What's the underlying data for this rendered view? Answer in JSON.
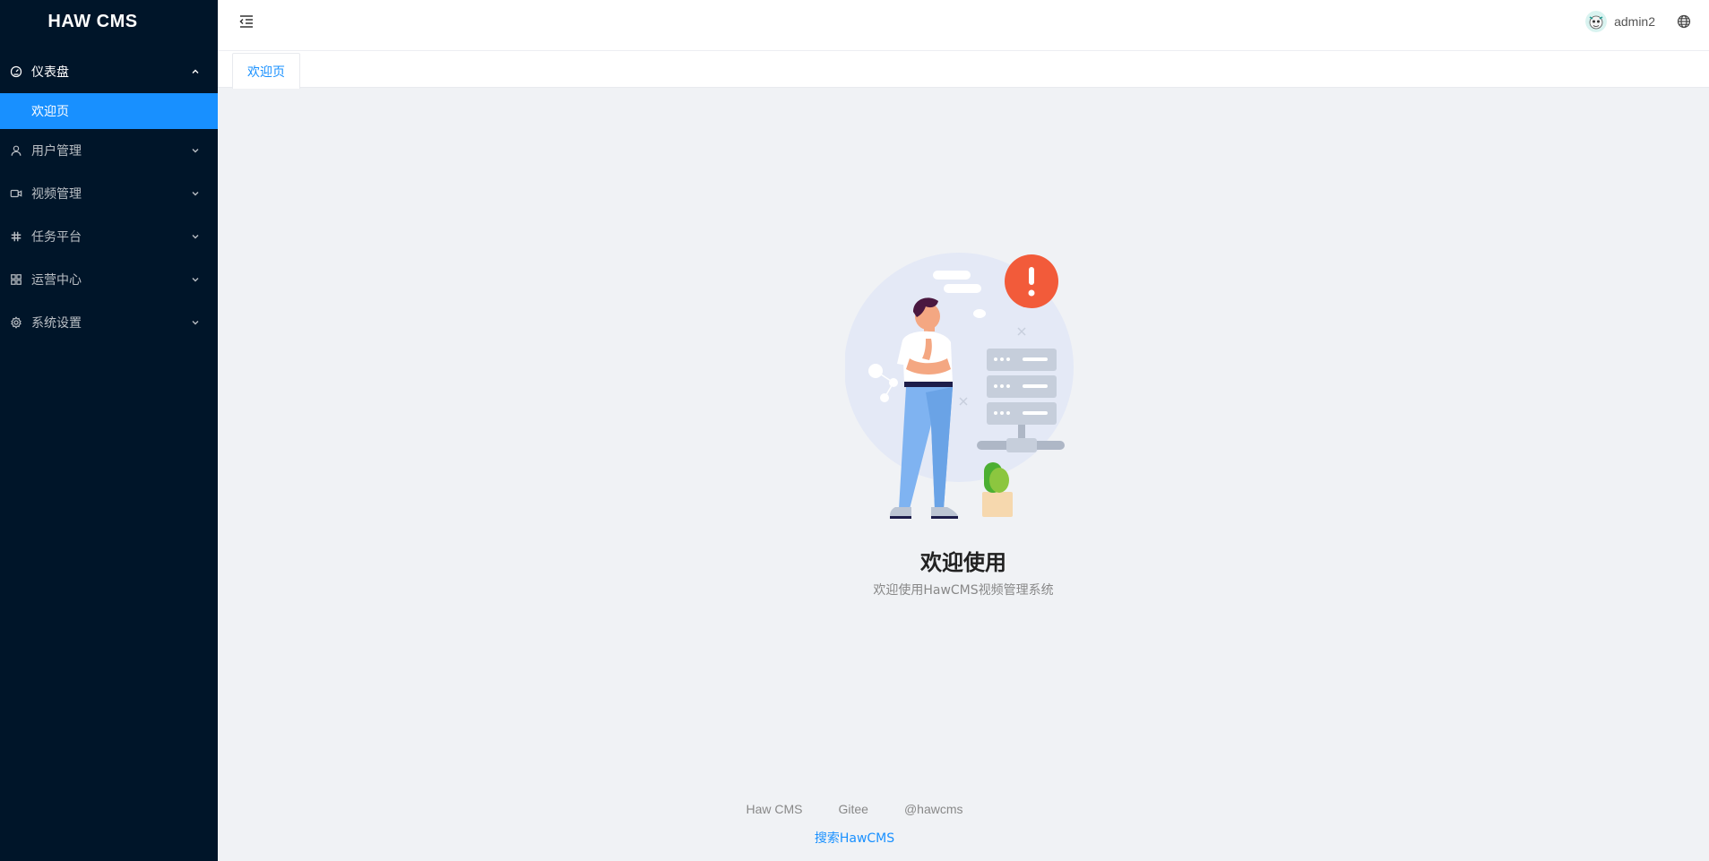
{
  "app": {
    "logo": "HAW CMS"
  },
  "sidebar": {
    "menus": [
      {
        "label": "仪表盘",
        "icon": "dashboard-icon"
      },
      {
        "label": "用户管理",
        "icon": "user-icon"
      },
      {
        "label": "视频管理",
        "icon": "video-icon"
      },
      {
        "label": "任务平台",
        "icon": "slack-icon"
      },
      {
        "label": "运营中心",
        "icon": "appstore-icon"
      },
      {
        "label": "系统设置",
        "icon": "setting-icon"
      }
    ],
    "submenu": {
      "label": "欢迎页"
    }
  },
  "header": {
    "username": "admin2",
    "user_icon": "avatar",
    "lang_icon": "globe-icon"
  },
  "tabs": [
    {
      "label": "欢迎页"
    }
  ],
  "main": {
    "title": "欢迎使用",
    "subtitle": "欢迎使用HawCMS视频管理系统"
  },
  "footer": {
    "links": [
      "Haw CMS",
      "Gitee",
      "@hawcms"
    ],
    "copyright": "搜索HawCMS"
  },
  "colors": {
    "sidebar_bg": "#001529",
    "accent": "#1890ff",
    "content_bg": "#f0f2f5"
  }
}
